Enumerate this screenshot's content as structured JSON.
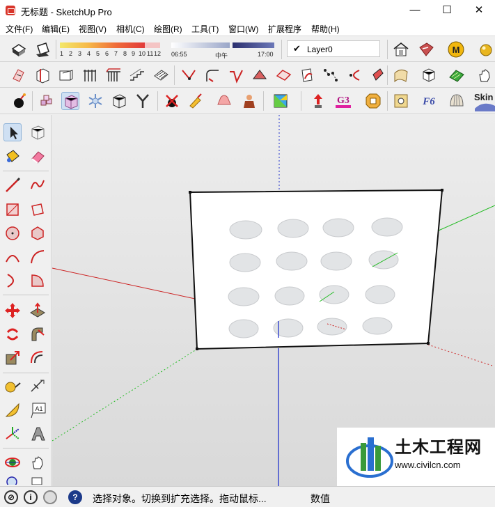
{
  "window": {
    "title": "无标题 - SketchUp Pro",
    "minimize": "—",
    "maximize": "☐",
    "close": "✕"
  },
  "menu": {
    "items": [
      "文件(F)",
      "编辑(E)",
      "视图(V)",
      "相机(C)",
      "绘图(R)",
      "工具(T)",
      "窗口(W)",
      "扩展程序",
      "帮助(H)"
    ]
  },
  "toolbar": {
    "shadow_months": [
      "1",
      "2",
      "3",
      "4",
      "5",
      "6",
      "7",
      "8",
      "9",
      "10",
      "11",
      "12"
    ],
    "time_start": "06:55",
    "time_mid": "中午",
    "time_end": "17:00",
    "layer_name": "Layer0",
    "skin_label": "Skin",
    "g3_label": "G3",
    "f6_label": "F6",
    "m_label": "M"
  },
  "left_toolbar": {
    "text_tool_label": "A1"
  },
  "status": {
    "text": "选择对象。切换到扩充选择。拖动鼠标...",
    "measurements_label": "数值"
  },
  "watermark": {
    "title": "土木工程网",
    "url": "www.civilcn.com"
  },
  "colors": {
    "red_axis": "#cc2222",
    "green_axis": "#22bb22",
    "blue_axis": "#2233cc",
    "face": "#ffffff",
    "hole": "#e2e4e6"
  }
}
